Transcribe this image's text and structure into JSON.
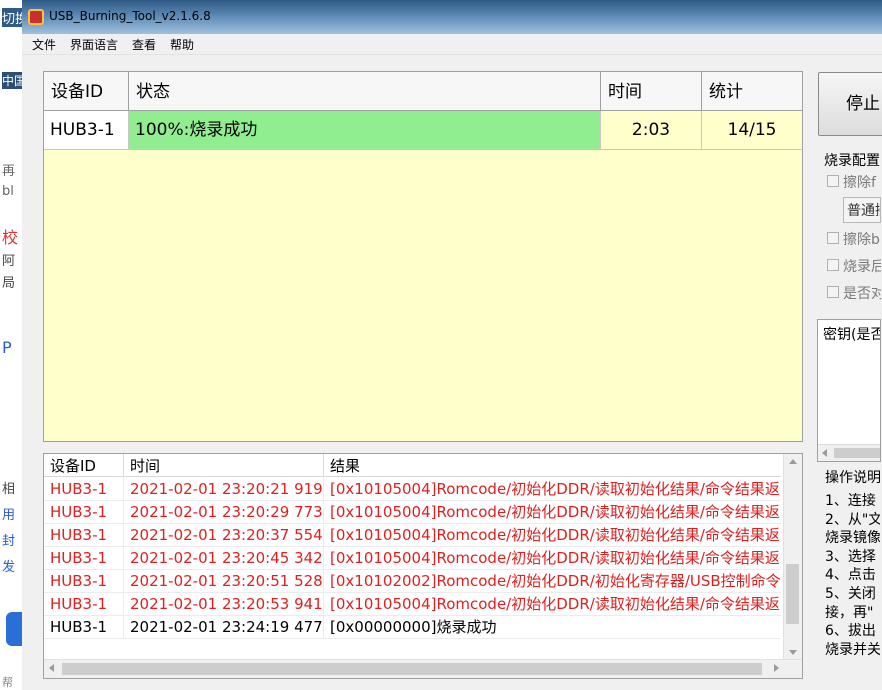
{
  "window": {
    "title": "USB_Burning_Tool_v2.1.6.8"
  },
  "menu": [
    "文件",
    "界面语言",
    "查看",
    "帮助"
  ],
  "desktop_fragments": [
    "切换",
    "中国",
    "再",
    "bl",
    "校",
    "阿",
    "局",
    "P",
    "相",
    "用",
    "封",
    "发",
    "帮"
  ],
  "devices": {
    "headers": [
      "设备ID",
      "状态",
      "时间",
      "统计"
    ],
    "rows": [
      {
        "id": "HUB3-1",
        "status": "100%:烧录成功",
        "time": "2:03",
        "count": "14/15",
        "status_color": "#90ee90"
      }
    ]
  },
  "log": {
    "headers": [
      "设备ID",
      "时间",
      "结果"
    ],
    "rows": [
      {
        "id": "HUB3-1",
        "time": "2021-02-01 23:20:21 919",
        "result": "[0x10105004]Romcode/初始化DDR/读取初始化结果/命令结果返",
        "color": "#e02020"
      },
      {
        "id": "HUB3-1",
        "time": "2021-02-01 23:20:29 773",
        "result": "[0x10105004]Romcode/初始化DDR/读取初始化结果/命令结果返",
        "color": "#e02020"
      },
      {
        "id": "HUB3-1",
        "time": "2021-02-01 23:20:37 554",
        "result": "[0x10105004]Romcode/初始化DDR/读取初始化结果/命令结果返",
        "color": "#e02020"
      },
      {
        "id": "HUB3-1",
        "time": "2021-02-01 23:20:45 342",
        "result": "[0x10105004]Romcode/初始化DDR/读取初始化结果/命令结果返",
        "color": "#e02020"
      },
      {
        "id": "HUB3-1",
        "time": "2021-02-01 23:20:51 528",
        "result": "[0x10102002]Romcode/初始化DDR/初始化寄存器/USB控制命令",
        "color": "#e02020"
      },
      {
        "id": "HUB3-1",
        "time": "2021-02-01 23:20:53 941",
        "result": "[0x10105004]Romcode/初始化DDR/读取初始化结果/命令结果返",
        "color": "#e02020"
      },
      {
        "id": "HUB3-1",
        "time": "2021-02-01 23:24:19 477",
        "result": "[0x00000000]烧录成功",
        "color": "#000000"
      }
    ]
  },
  "right_panel": {
    "stop_label": "停止",
    "config_title": "烧录配置",
    "checkbox1": "擦除f",
    "combo_value": "普通擦",
    "checkbox2": "擦除b",
    "checkbox3": "烧录后",
    "checkbox4": "是否对",
    "key_title": "密钥(是否",
    "instructions_title": "操作说明",
    "instructions": [
      "1、连接",
      "2、从\"文",
      "烧录镜像",
      "3、选择",
      "4、点击",
      "5、关闭",
      "接，再\"",
      "6、拔出",
      "烧录并关"
    ]
  },
  "colors": {
    "accent_success": "#90ee90",
    "error_text": "#e02020",
    "table_bg": "#ffffcc"
  }
}
